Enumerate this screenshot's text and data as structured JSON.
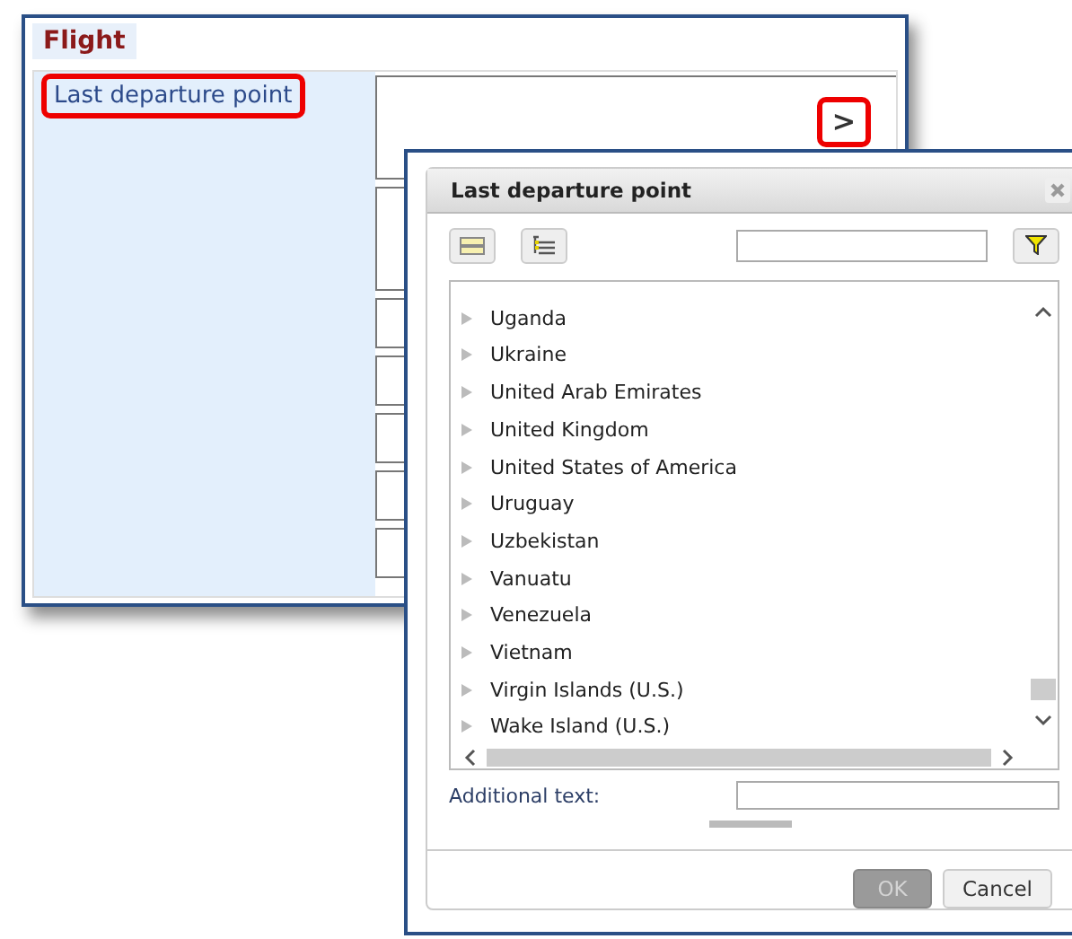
{
  "form": {
    "title": "Flight",
    "field_label": "Last departure point",
    "label_highlighted": true,
    "open_button": {
      "label": ">",
      "highlighted": true
    }
  },
  "dialog": {
    "title": "Last departure point",
    "items": [
      {
        "label": "Uganda"
      },
      {
        "label": "Ukraine"
      },
      {
        "label": "United Arab Emirates"
      },
      {
        "label": "United Kingdom"
      },
      {
        "label": "United States of America"
      },
      {
        "label": "Uruguay"
      },
      {
        "label": "Uzbekistan"
      },
      {
        "label": "Vanuatu"
      },
      {
        "label": "Venezuela"
      },
      {
        "label": "Vietnam"
      },
      {
        "label": "Virgin Islands (U.S.)"
      },
      {
        "label": "Wake Island (U.S.)"
      }
    ],
    "additional_text_label": "Additional text:",
    "buttons": [
      {
        "label": "OK",
        "disabled": true
      },
      {
        "label": "Cancel",
        "disabled": false
      }
    ]
  }
}
